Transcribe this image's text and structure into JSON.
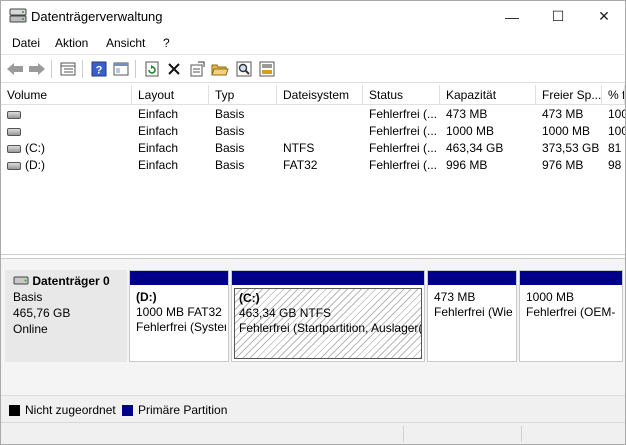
{
  "window": {
    "title": "Datenträgerverwaltung"
  },
  "window_controls": {
    "minimize": "—",
    "maximize": "☐",
    "close": "✕"
  },
  "menu": [
    "Datei",
    "Aktion",
    "Ansicht",
    "?"
  ],
  "toolbar": {
    "icons": [
      "back-icon",
      "forward-icon",
      "list-view-icon",
      "help-icon",
      "console-icon",
      "refresh-icon",
      "delete-icon",
      "properties-icon",
      "open-folder-icon",
      "search-icon",
      "disk-settings-icon"
    ]
  },
  "volume_table": {
    "columns": [
      "Volume",
      "Layout",
      "Typ",
      "Dateisystem",
      "Status",
      "Kapazität",
      "Freier Sp...",
      "% f"
    ],
    "rows": [
      [
        "",
        "Einfach",
        "Basis",
        "",
        "Fehlerfrei (...",
        "473 MB",
        "473 MB",
        "100"
      ],
      [
        "",
        "Einfach",
        "Basis",
        "",
        "Fehlerfrei (...",
        "1000 MB",
        "1000 MB",
        "100"
      ],
      [
        "(C:)",
        "Einfach",
        "Basis",
        "NTFS",
        "Fehlerfrei (...",
        "463,34 GB",
        "373,53 GB",
        "81"
      ],
      [
        "(D:)",
        "Einfach",
        "Basis",
        "FAT32",
        "Fehlerfrei (...",
        "996 MB",
        "976 MB",
        "98"
      ]
    ]
  },
  "disk": {
    "name": "Datenträger 0",
    "type": "Basis",
    "size": "465,76 GB",
    "state": "Online"
  },
  "partitions": [
    {
      "name": "(D:)",
      "size": "1000 MB FAT32",
      "status": "Fehlerfrei (Syster"
    },
    {
      "name": "(C:)",
      "size": "463,34 GB NTFS",
      "status": "Fehlerfrei (Startpartition, Auslager("
    },
    {
      "name": "",
      "size": "473 MB",
      "status": "Fehlerfrei (Wie"
    },
    {
      "name": "",
      "size": "1000 MB",
      "status": "Fehlerfrei (OEM-"
    }
  ],
  "legend": {
    "unallocated": "Nicht zugeordnet",
    "primary": "Primäre Partition"
  },
  "colors": {
    "primary_partition": "#00008b",
    "unallocated": "#000000"
  }
}
